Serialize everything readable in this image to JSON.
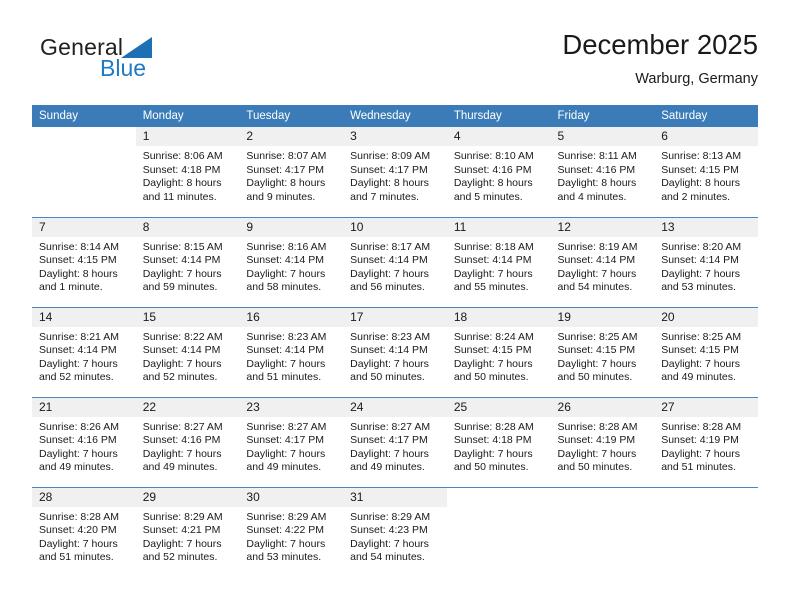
{
  "brand": {
    "name_part1": "General",
    "name_part2": "Blue",
    "triangle_color": "#1f6fb5",
    "blue_color": "#1f7ac4"
  },
  "header": {
    "title": "December 2025",
    "subtitle": "Warburg, Germany"
  },
  "theme": {
    "header_bg": "#3b7cb8",
    "daynum_bg": "#f0f0f0",
    "row_divider": "#4a87bd",
    "text": "#1a1a1a"
  },
  "weekday_headers": [
    "Sunday",
    "Monday",
    "Tuesday",
    "Wednesday",
    "Thursday",
    "Friday",
    "Saturday"
  ],
  "weeks": [
    [
      {
        "day": "",
        "sunrise": "",
        "sunset": "",
        "daylight1": "",
        "daylight2": ""
      },
      {
        "day": "1",
        "sunrise": "Sunrise: 8:06 AM",
        "sunset": "Sunset: 4:18 PM",
        "daylight1": "Daylight: 8 hours",
        "daylight2": "and 11 minutes."
      },
      {
        "day": "2",
        "sunrise": "Sunrise: 8:07 AM",
        "sunset": "Sunset: 4:17 PM",
        "daylight1": "Daylight: 8 hours",
        "daylight2": "and 9 minutes."
      },
      {
        "day": "3",
        "sunrise": "Sunrise: 8:09 AM",
        "sunset": "Sunset: 4:17 PM",
        "daylight1": "Daylight: 8 hours",
        "daylight2": "and 7 minutes."
      },
      {
        "day": "4",
        "sunrise": "Sunrise: 8:10 AM",
        "sunset": "Sunset: 4:16 PM",
        "daylight1": "Daylight: 8 hours",
        "daylight2": "and 5 minutes."
      },
      {
        "day": "5",
        "sunrise": "Sunrise: 8:11 AM",
        "sunset": "Sunset: 4:16 PM",
        "daylight1": "Daylight: 8 hours",
        "daylight2": "and 4 minutes."
      },
      {
        "day": "6",
        "sunrise": "Sunrise: 8:13 AM",
        "sunset": "Sunset: 4:15 PM",
        "daylight1": "Daylight: 8 hours",
        "daylight2": "and 2 minutes."
      }
    ],
    [
      {
        "day": "7",
        "sunrise": "Sunrise: 8:14 AM",
        "sunset": "Sunset: 4:15 PM",
        "daylight1": "Daylight: 8 hours",
        "daylight2": "and 1 minute."
      },
      {
        "day": "8",
        "sunrise": "Sunrise: 8:15 AM",
        "sunset": "Sunset: 4:14 PM",
        "daylight1": "Daylight: 7 hours",
        "daylight2": "and 59 minutes."
      },
      {
        "day": "9",
        "sunrise": "Sunrise: 8:16 AM",
        "sunset": "Sunset: 4:14 PM",
        "daylight1": "Daylight: 7 hours",
        "daylight2": "and 58 minutes."
      },
      {
        "day": "10",
        "sunrise": "Sunrise: 8:17 AM",
        "sunset": "Sunset: 4:14 PM",
        "daylight1": "Daylight: 7 hours",
        "daylight2": "and 56 minutes."
      },
      {
        "day": "11",
        "sunrise": "Sunrise: 8:18 AM",
        "sunset": "Sunset: 4:14 PM",
        "daylight1": "Daylight: 7 hours",
        "daylight2": "and 55 minutes."
      },
      {
        "day": "12",
        "sunrise": "Sunrise: 8:19 AM",
        "sunset": "Sunset: 4:14 PM",
        "daylight1": "Daylight: 7 hours",
        "daylight2": "and 54 minutes."
      },
      {
        "day": "13",
        "sunrise": "Sunrise: 8:20 AM",
        "sunset": "Sunset: 4:14 PM",
        "daylight1": "Daylight: 7 hours",
        "daylight2": "and 53 minutes."
      }
    ],
    [
      {
        "day": "14",
        "sunrise": "Sunrise: 8:21 AM",
        "sunset": "Sunset: 4:14 PM",
        "daylight1": "Daylight: 7 hours",
        "daylight2": "and 52 minutes."
      },
      {
        "day": "15",
        "sunrise": "Sunrise: 8:22 AM",
        "sunset": "Sunset: 4:14 PM",
        "daylight1": "Daylight: 7 hours",
        "daylight2": "and 52 minutes."
      },
      {
        "day": "16",
        "sunrise": "Sunrise: 8:23 AM",
        "sunset": "Sunset: 4:14 PM",
        "daylight1": "Daylight: 7 hours",
        "daylight2": "and 51 minutes."
      },
      {
        "day": "17",
        "sunrise": "Sunrise: 8:23 AM",
        "sunset": "Sunset: 4:14 PM",
        "daylight1": "Daylight: 7 hours",
        "daylight2": "and 50 minutes."
      },
      {
        "day": "18",
        "sunrise": "Sunrise: 8:24 AM",
        "sunset": "Sunset: 4:15 PM",
        "daylight1": "Daylight: 7 hours",
        "daylight2": "and 50 minutes."
      },
      {
        "day": "19",
        "sunrise": "Sunrise: 8:25 AM",
        "sunset": "Sunset: 4:15 PM",
        "daylight1": "Daylight: 7 hours",
        "daylight2": "and 50 minutes."
      },
      {
        "day": "20",
        "sunrise": "Sunrise: 8:25 AM",
        "sunset": "Sunset: 4:15 PM",
        "daylight1": "Daylight: 7 hours",
        "daylight2": "and 49 minutes."
      }
    ],
    [
      {
        "day": "21",
        "sunrise": "Sunrise: 8:26 AM",
        "sunset": "Sunset: 4:16 PM",
        "daylight1": "Daylight: 7 hours",
        "daylight2": "and 49 minutes."
      },
      {
        "day": "22",
        "sunrise": "Sunrise: 8:27 AM",
        "sunset": "Sunset: 4:16 PM",
        "daylight1": "Daylight: 7 hours",
        "daylight2": "and 49 minutes."
      },
      {
        "day": "23",
        "sunrise": "Sunrise: 8:27 AM",
        "sunset": "Sunset: 4:17 PM",
        "daylight1": "Daylight: 7 hours",
        "daylight2": "and 49 minutes."
      },
      {
        "day": "24",
        "sunrise": "Sunrise: 8:27 AM",
        "sunset": "Sunset: 4:17 PM",
        "daylight1": "Daylight: 7 hours",
        "daylight2": "and 49 minutes."
      },
      {
        "day": "25",
        "sunrise": "Sunrise: 8:28 AM",
        "sunset": "Sunset: 4:18 PM",
        "daylight1": "Daylight: 7 hours",
        "daylight2": "and 50 minutes."
      },
      {
        "day": "26",
        "sunrise": "Sunrise: 8:28 AM",
        "sunset": "Sunset: 4:19 PM",
        "daylight1": "Daylight: 7 hours",
        "daylight2": "and 50 minutes."
      },
      {
        "day": "27",
        "sunrise": "Sunrise: 8:28 AM",
        "sunset": "Sunset: 4:19 PM",
        "daylight1": "Daylight: 7 hours",
        "daylight2": "and 51 minutes."
      }
    ],
    [
      {
        "day": "28",
        "sunrise": "Sunrise: 8:28 AM",
        "sunset": "Sunset: 4:20 PM",
        "daylight1": "Daylight: 7 hours",
        "daylight2": "and 51 minutes."
      },
      {
        "day": "29",
        "sunrise": "Sunrise: 8:29 AM",
        "sunset": "Sunset: 4:21 PM",
        "daylight1": "Daylight: 7 hours",
        "daylight2": "and 52 minutes."
      },
      {
        "day": "30",
        "sunrise": "Sunrise: 8:29 AM",
        "sunset": "Sunset: 4:22 PM",
        "daylight1": "Daylight: 7 hours",
        "daylight2": "and 53 minutes."
      },
      {
        "day": "31",
        "sunrise": "Sunrise: 8:29 AM",
        "sunset": "Sunset: 4:23 PM",
        "daylight1": "Daylight: 7 hours",
        "daylight2": "and 54 minutes."
      },
      {
        "day": "",
        "sunrise": "",
        "sunset": "",
        "daylight1": "",
        "daylight2": ""
      },
      {
        "day": "",
        "sunrise": "",
        "sunset": "",
        "daylight1": "",
        "daylight2": ""
      },
      {
        "day": "",
        "sunrise": "",
        "sunset": "",
        "daylight1": "",
        "daylight2": ""
      }
    ]
  ]
}
